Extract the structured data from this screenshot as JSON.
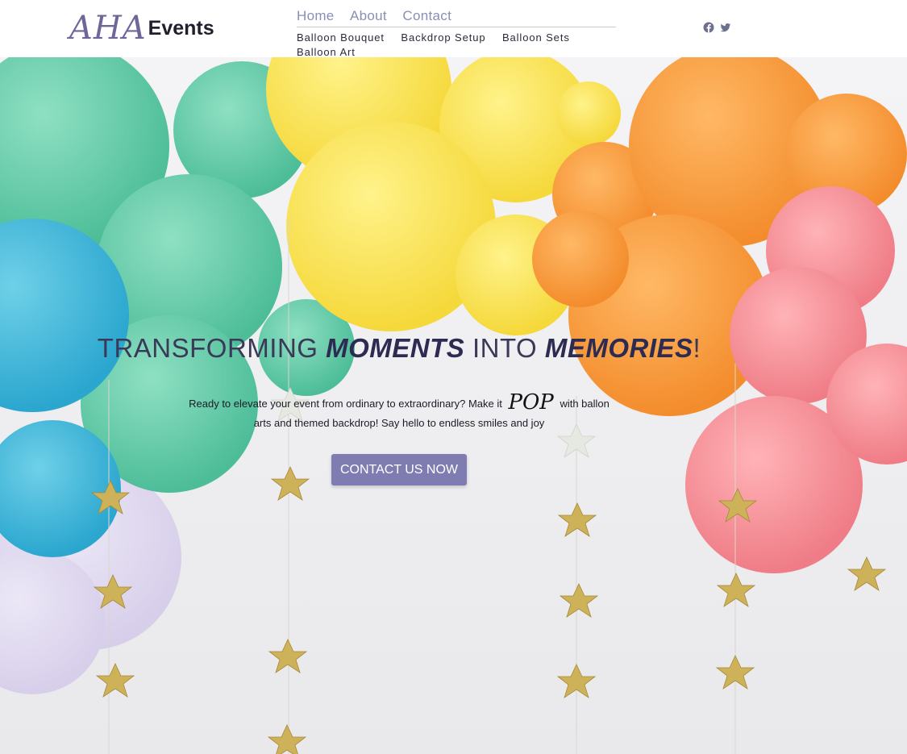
{
  "brand": {
    "logo_script": "AHA",
    "logo_word": "Events"
  },
  "nav": {
    "main": [
      "Home",
      "About",
      "Contact"
    ],
    "sub": [
      "Balloon Bouquet",
      "Backdrop Setup",
      "Balloon Sets",
      "Balloon Art"
    ]
  },
  "social": {
    "icons": [
      "facebook-icon",
      "twitter-icon"
    ]
  },
  "hero": {
    "headline": {
      "part1": "TRANSFORMING ",
      "emph1": "MOMENTS",
      "part2": " INTO ",
      "emph2": "MEMORIES",
      "part3": "!"
    },
    "tagline": {
      "before": "Ready to elevate your event from ordinary to extraordinary? Make it",
      "pop": "POP",
      "after": "with ballon arts and themed backdrop! Say hello to endless smiles and joy"
    },
    "cta_label": "CONTACT US NOW"
  },
  "colors": {
    "accent": "#7f7cb1",
    "logo_script": "#6d6699",
    "nav_link": "#8a8fb3",
    "headline": "#3a3a58"
  }
}
